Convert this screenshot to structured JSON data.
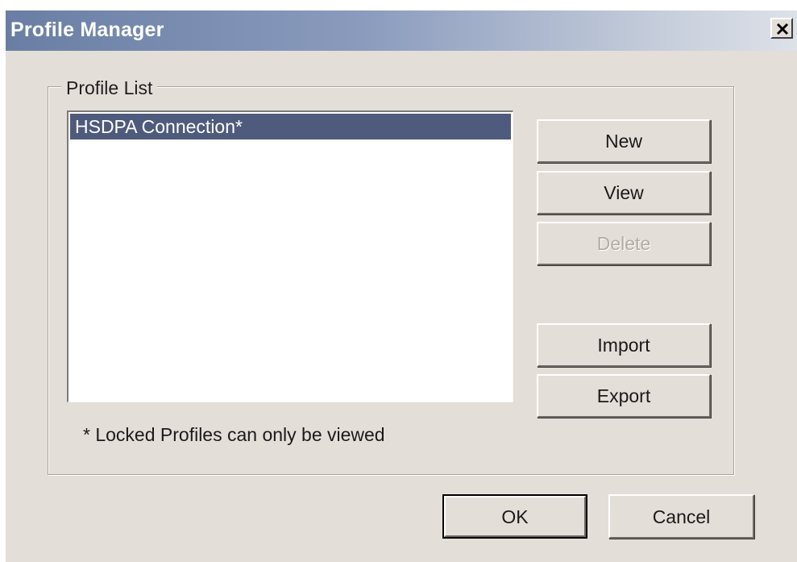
{
  "window": {
    "title": "Profile Manager",
    "close_glyph": "✕"
  },
  "profile_list": {
    "legend": "Profile List",
    "items": [
      {
        "label": "HSDPA Connection*",
        "selected": true
      }
    ],
    "note": "* Locked Profiles can only be viewed"
  },
  "side_buttons": {
    "new_label": "New",
    "view_label": "View",
    "delete_label": "Delete",
    "import_label": "Import",
    "export_label": "Export"
  },
  "footer": {
    "ok_label": "OK",
    "cancel_label": "Cancel"
  },
  "colors": {
    "dialog_bg": "#e4ded8",
    "selection_bg": "#4f5b7c",
    "titlebar_start": "#6a7ea4",
    "titlebar_end": "#dde1e8"
  }
}
